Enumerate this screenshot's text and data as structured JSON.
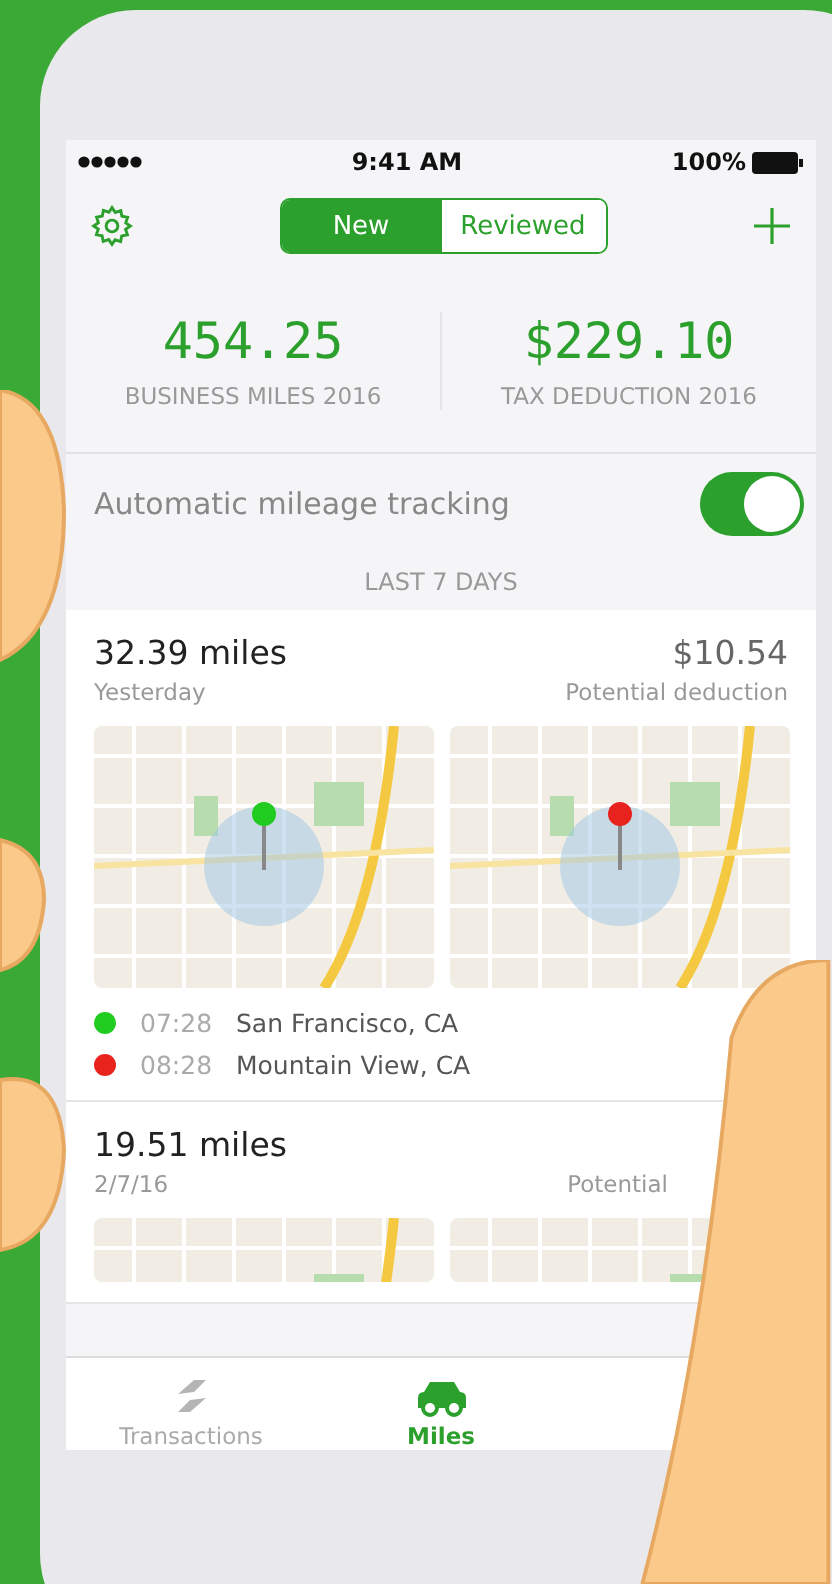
{
  "status_bar": {
    "time": "9:41 AM",
    "battery": "100%"
  },
  "segments": [
    {
      "label": "New",
      "selected": true
    },
    {
      "label": "Reviewed",
      "selected": false
    }
  ],
  "stats": [
    {
      "value": "454.25",
      "label": "BUSINESS MILES 2016"
    },
    {
      "value": "$229.10",
      "label": "TAX DEDUCTION 2016"
    }
  ],
  "tracking": {
    "label": "Automatic mileage tracking",
    "on": true
  },
  "section_header": "LAST 7 DAYS",
  "trips": [
    {
      "miles": "32.39 miles",
      "date": "Yesterday",
      "deduction": "$10.54",
      "deduction_label": "Potential deduction",
      "stops": [
        {
          "time": "07:28",
          "place": "San Francisco, CA",
          "color": "#1fcc1f"
        },
        {
          "time": "08:28",
          "place": "Mountain View, CA",
          "color": "#e8231e"
        }
      ]
    },
    {
      "miles": "19.51 miles",
      "date": "2/7/16",
      "deduction_label": "Potential"
    }
  ],
  "tab_bar": [
    {
      "label": "Transactions",
      "kind": "transactions",
      "selected": false
    },
    {
      "label": "Miles",
      "kind": "miles",
      "selected": true
    }
  ]
}
